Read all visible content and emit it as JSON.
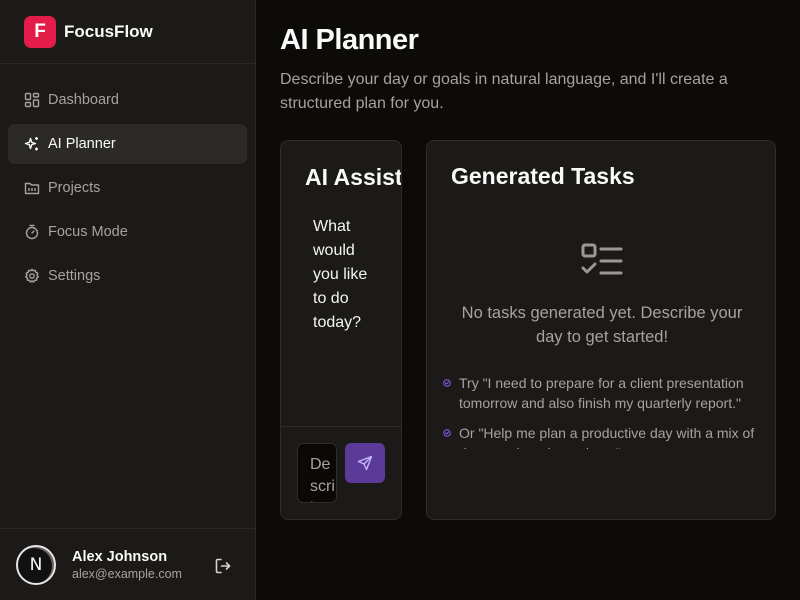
{
  "brand": {
    "logo_letter": "F",
    "name": "FocusFlow",
    "accent": "#e11d48"
  },
  "nav": {
    "items": [
      {
        "label": "Dashboard",
        "icon": "dashboard-icon",
        "active": false
      },
      {
        "label": "AI Planner",
        "icon": "sparkles-icon",
        "active": true
      },
      {
        "label": "Projects",
        "icon": "folder-icon",
        "active": false
      },
      {
        "label": "Focus Mode",
        "icon": "timer-icon",
        "active": false
      },
      {
        "label": "Settings",
        "icon": "gear-icon",
        "active": false
      }
    ]
  },
  "user": {
    "avatar_letter": "N",
    "name": "Alex Johnson",
    "email": "alex@example.com"
  },
  "page": {
    "title": "AI Planner",
    "description": "Describe your day or goals in natural language, and I'll create a structured plan for you."
  },
  "assistant": {
    "title": "AI Assistant",
    "message": "What would you like to do today?",
    "input_placeholder": "Describe your day...",
    "send_color": "#5b3a99"
  },
  "tasks": {
    "title": "Generated Tasks",
    "empty_text": "No tasks generated yet. Describe your day to get started!",
    "suggestions": [
      "Try \"I need to prepare for a client presentation tomorrow and also finish my quarterly report.\"",
      "Or \"Help me plan a productive day with a mix of deep work and meetings.\""
    ]
  }
}
